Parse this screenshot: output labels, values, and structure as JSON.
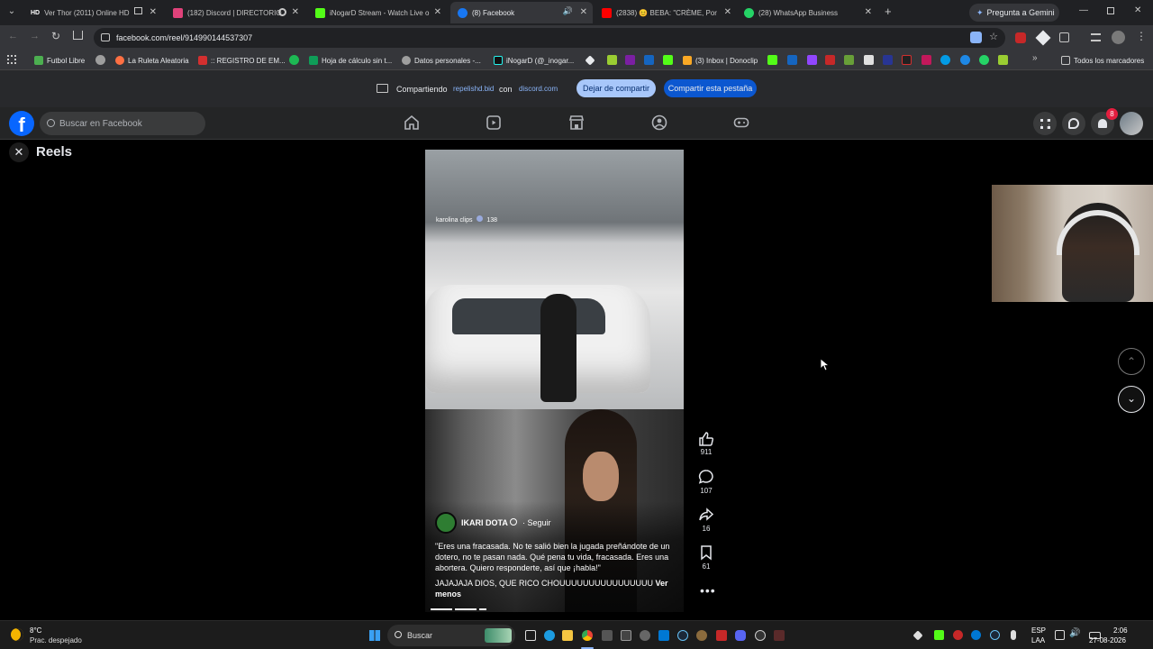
{
  "browser": {
    "tabs": [
      {
        "label": "Ver Thor (2011) Online HD",
        "badge": "HD"
      },
      {
        "label": "(182) Discord | DIRECTORIO"
      },
      {
        "label": "iNogarD Stream - Watch Live o"
      },
      {
        "label": "(8) Facebook"
      },
      {
        "label": "(2838) 😊 BEBA: \"CRÈME, Por"
      },
      {
        "label": "(28) WhatsApp Business"
      }
    ],
    "gemini_label": "Pregunta a Gemini",
    "url": "facebook.com/reel/914990144537307",
    "bookmarks": [
      {
        "label": "Futbol Libre"
      },
      {
        "label": "La Ruleta Aleatoria"
      },
      {
        "label": ":: REGISTRO DE EM..."
      },
      {
        "label": "Hoja de cálculo sin t..."
      },
      {
        "label": "Datos personales -..."
      },
      {
        "label": "iNogarD (@_inogar..."
      },
      {
        "label": "(3) Inbox | Donoclip"
      }
    ],
    "all_bookmarks_label": "Todos los marcadores",
    "share": {
      "sharing_label": "Compartiendo",
      "sharing_site": "repelishd.bid",
      "with_label": "con",
      "with_site": "discord.com",
      "stop_button": "Dejar de compartir",
      "share_tab_button": "Compartir esta pestaña"
    }
  },
  "facebook": {
    "search_placeholder": "Buscar en Facebook",
    "notification_count": "8",
    "reels_title": "Reels",
    "reel": {
      "watermark_user": "karolina clips",
      "watermark_count": "138",
      "author": "IKARI DOTA",
      "follow_label": "· Seguir",
      "caption_quote": "\"Eres una fracasada. No te salió bien la jugada preñándote de un dotero, no te pasan nada. Qué pena tu vida, fracasada. Eres una abortera. Quiero responderte, así que ¡habla!\"",
      "caption_text": "JAJAJAJA DIOS, QUE RICO CHOUUUUUUUUUUUUUUUU",
      "see_more": "Ver menos",
      "likes": "911",
      "comments": "107",
      "shares": "16",
      "saves": "61"
    }
  },
  "taskbar": {
    "weather_temp": "8°C",
    "weather_desc": "Prac. despejado",
    "search_label": "Buscar",
    "lang_line1": "ESP",
    "lang_line2": "LAA",
    "time": "2:06",
    "date": "27-08-2026"
  }
}
